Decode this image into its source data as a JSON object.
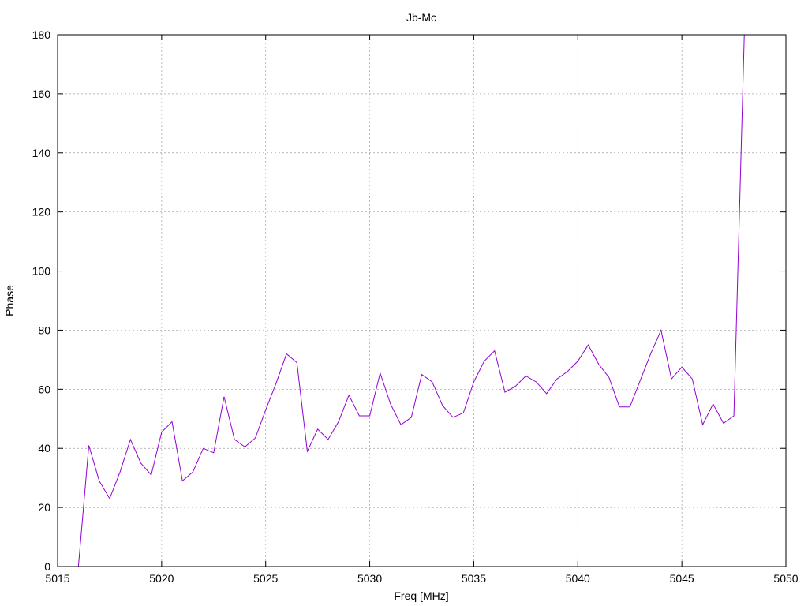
{
  "chart_data": {
    "type": "line",
    "title": "Jb-Mc",
    "xlabel": "Freq [MHz]",
    "ylabel": "Phase",
    "xlim": [
      5015,
      5050
    ],
    "ylim": [
      0,
      180
    ],
    "xticks": [
      5015,
      5020,
      5025,
      5030,
      5035,
      5040,
      5045,
      5050
    ],
    "yticks": [
      0,
      20,
      40,
      60,
      80,
      100,
      120,
      140,
      160,
      180
    ],
    "grid": true,
    "line_color": "#9400d3",
    "series": [
      {
        "x": [
          5016.0,
          5016.5,
          5017.0,
          5017.5,
          5018.0,
          5018.5,
          5019.0,
          5019.5,
          5020.0,
          5020.5,
          5021.0,
          5021.5,
          5022.0,
          5022.5,
          5023.0,
          5023.5,
          5024.0,
          5024.5,
          5025.0,
          5025.5,
          5026.0,
          5026.5,
          5027.0,
          5027.5,
          5028.0,
          5028.5,
          5029.0,
          5029.5,
          5030.0,
          5030.5,
          5031.0,
          5031.5,
          5032.0,
          5032.5,
          5033.0,
          5033.5,
          5034.0,
          5034.5,
          5035.0,
          5035.5,
          5036.0,
          5036.5,
          5037.0,
          5037.5,
          5038.0,
          5038.5,
          5039.0,
          5039.5,
          5040.0,
          5040.5,
          5041.0,
          5041.5,
          5042.0,
          5042.5,
          5043.0,
          5043.5,
          5044.0,
          5044.5,
          5045.0,
          5045.5,
          5046.0,
          5046.5,
          5047.0,
          5047.5,
          5048.0
        ],
        "y": [
          0,
          41,
          29,
          23,
          32,
          43,
          35,
          31,
          45.5,
          49,
          29,
          32,
          40,
          38.5,
          57.5,
          43,
          40.5,
          43.5,
          53,
          62,
          72,
          69,
          39,
          46.5,
          43,
          49,
          58,
          51,
          51,
          65.5,
          55,
          48,
          50.5,
          65,
          62.5,
          54.5,
          50.5,
          52,
          62.5,
          69.5,
          73,
          59,
          61,
          64.5,
          62.5,
          58.5,
          63.5,
          66,
          69.5,
          75,
          68.5,
          64,
          54,
          54,
          63,
          72,
          80,
          63.5,
          67.5,
          63.5,
          48,
          55,
          48.5,
          51,
          180
        ]
      }
    ]
  }
}
